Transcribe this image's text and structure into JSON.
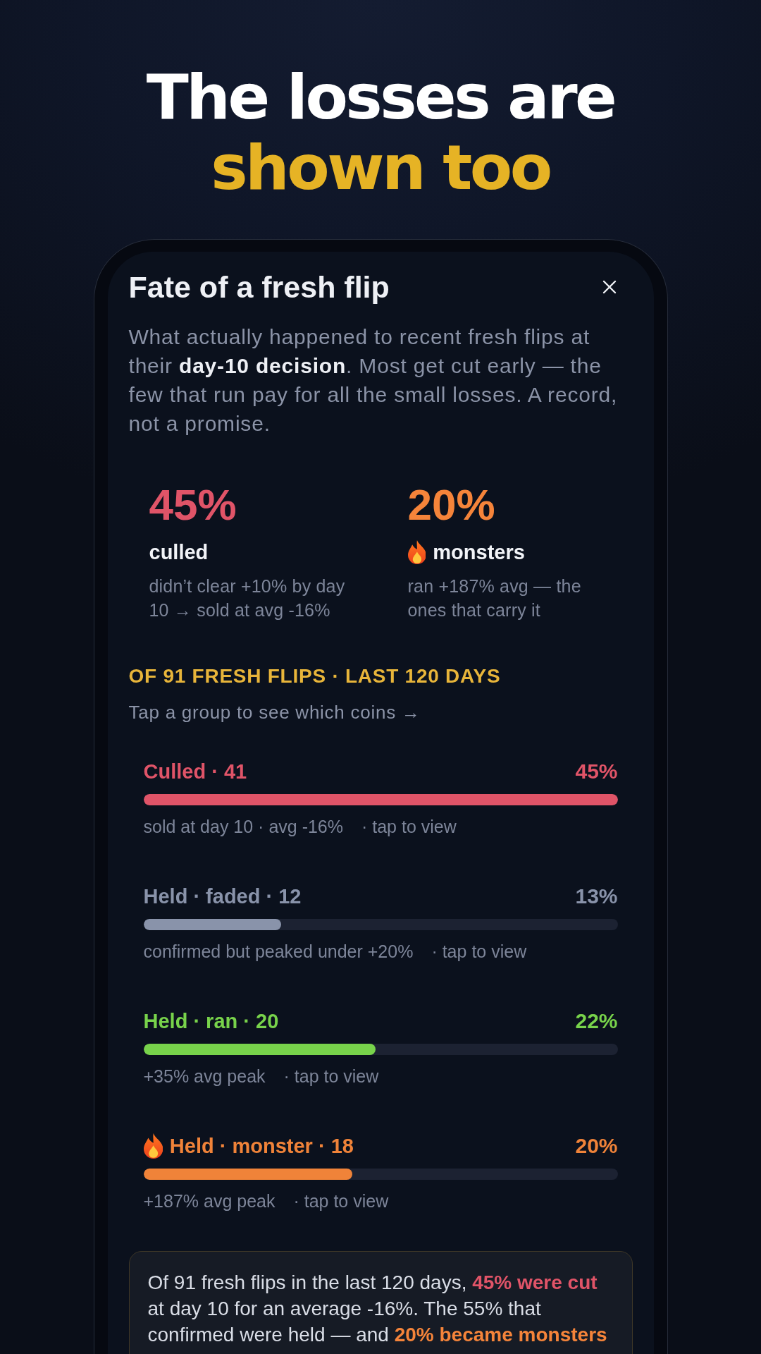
{
  "headline": [
    {
      "text": "The losses are",
      "kind": "plain"
    },
    {
      "text": "shown too",
      "kind": "accent"
    }
  ],
  "sheet": {
    "title": "Fate of a fresh flip",
    "description": "What actually happened to recent fresh flips at their **day-10 decision**. Most get cut early — the few that run pay for all the small losses. A record, not a promise."
  },
  "stats": [
    {
      "value": "45%",
      "label": "culled",
      "note": "didn’t clear +10% by day 10 → sold at avg -16%",
      "color": "#e05468",
      "kind": "plain"
    },
    {
      "value": "20%",
      "label": "monsters",
      "note": "ran +187% avg — the ones that carry it",
      "color": "#f5843a",
      "kind": "flame"
    }
  ],
  "section": {
    "heading": "OF 91 FRESH FLIPS · LAST 120 DAYS",
    "hint": "Tap a group to see which coins →"
  },
  "groups": [
    {
      "name": "Culled · 41",
      "share": "45%",
      "level": 1,
      "detail": "sold at day 10 · avg -16%",
      "link": "· tap to view",
      "color": "#e05468",
      "kind": "plain"
    },
    {
      "name": "Held · faded · 12",
      "share": "13%",
      "level": 0.29,
      "detail": "confirmed but peaked under +20%",
      "link": "· tap to view",
      "color": "#8993aa",
      "kind": "plain"
    },
    {
      "name": "Held · ran · 20",
      "share": "22%",
      "level": 0.49,
      "detail": "+35% avg peak",
      "link": "· tap to view",
      "color": "#78d34b",
      "kind": "plain"
    },
    {
      "name": "Held · monster · 18",
      "share": "20%",
      "level": 0.44,
      "detail": "+187% avg peak",
      "link": "· tap to view",
      "color": "#f08339",
      "kind": "flame"
    }
  ],
  "summary": [
    {
      "text": "Of 91 fresh flips in the last 120 days, ",
      "kind": "plain"
    },
    {
      "text": "45% were cut",
      "kind": "loss"
    },
    {
      "text": " at day 10 for an average -16%. The 55% that confirmed were held — and ",
      "kind": "plain"
    },
    {
      "text": "20% became monsters",
      "kind": "monster"
    }
  ]
}
